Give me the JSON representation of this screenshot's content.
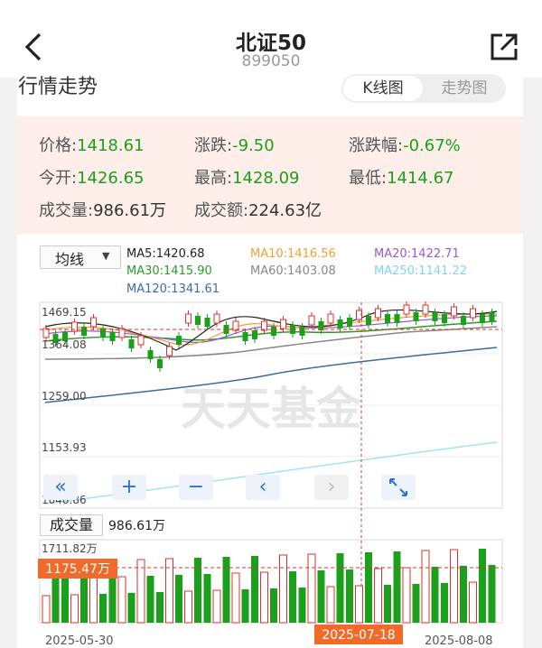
{
  "header": {
    "title": "北证50",
    "code": "899050"
  },
  "section": {
    "title": "行情走势",
    "tabs": [
      "K线图",
      "走势图"
    ]
  },
  "quote": {
    "price_label": "价格:",
    "price": "1418.61",
    "change_label": "涨跌:",
    "change": "-9.50",
    "pct_label": "涨跌幅:",
    "pct": "-0.67%",
    "open_label": "今开:",
    "open": "1426.65",
    "high_label": "最高:",
    "high": "1428.09",
    "low_label": "最低:",
    "low": "1414.67",
    "vol_label": "成交量:",
    "vol": "986.61万",
    "amt_label": "成交额:",
    "amt": "224.63亿"
  },
  "indicator": {
    "select": "均线",
    "caret": "▼"
  },
  "ma": {
    "ma5": "MA5:1420.68",
    "ma10": "MA10:1416.56",
    "ma20": "MA20:1422.71",
    "ma30": "MA30:1415.90",
    "ma60": "MA60:1403.08",
    "ma250": "MA250:1141.22",
    "ma120": "MA120:1341.61"
  },
  "colors": {
    "up": "#e0302e",
    "down": "#1aa01a",
    "ma5": "#222222",
    "ma10": "#f0a030",
    "ma20": "#9b59d0",
    "ma30": "#2a9a2a",
    "ma60": "#888888",
    "ma250": "#8fdfee",
    "ma120": "#3d6aa0"
  },
  "axis": {
    "y1": "1469.15",
    "y2": "1364.08",
    "y3": "1259.00",
    "y4": "1153.93",
    "y5": "1048.86",
    "vol_max": "1711.82万",
    "marker": "1175.47万"
  },
  "dates": {
    "start": "2025-05-30",
    "cross": "2025-07-18",
    "end": "2025-08-08"
  },
  "volume": {
    "label": "成交量",
    "value": "986.61万"
  },
  "watermark": "天天基金",
  "controls": {
    "first": "«",
    "zoom_in": "+",
    "zoom_out": "−",
    "prev": "‹",
    "next": "›"
  }
}
